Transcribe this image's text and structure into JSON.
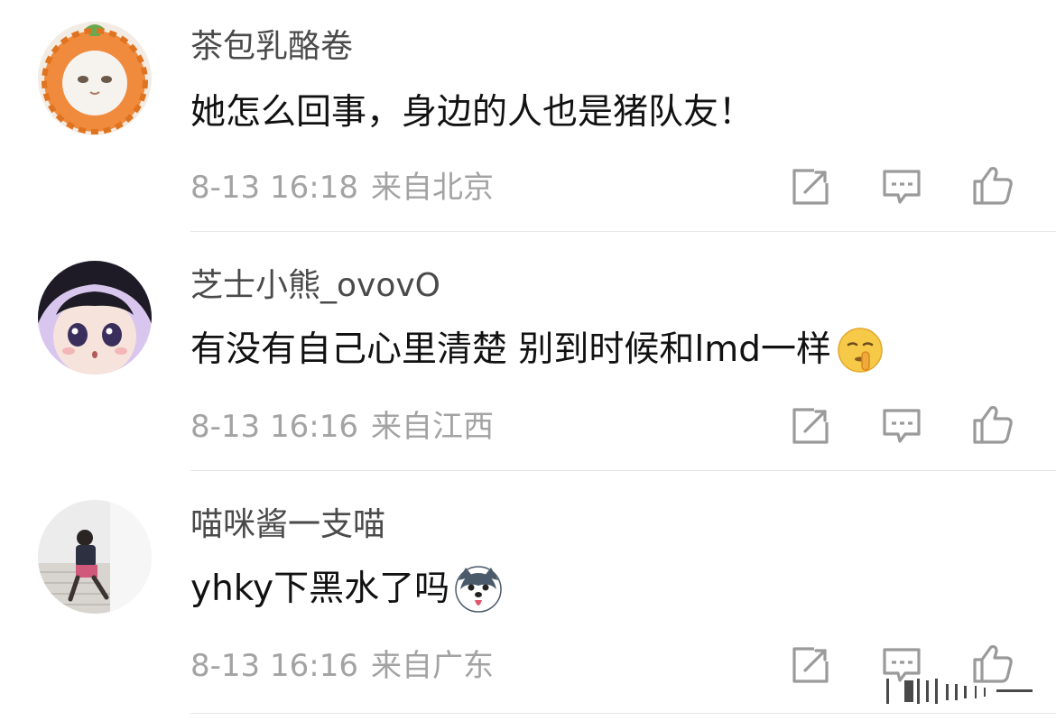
{
  "comments": [
    {
      "username": "茶包乳酪卷",
      "text": "她怎么回事，身边的人也是猪队友！",
      "time": "8-13 16:18",
      "location": "来自北京",
      "emoji": ""
    },
    {
      "username": "芝士小熊_ovovO",
      "text": "有没有自己心里清楚 别到时候和lmd一样",
      "time": "8-13 16:16",
      "location": "来自江西",
      "emoji": "shush-face-emoji"
    },
    {
      "username": "喵咪酱一支喵",
      "text": "yhky下黑水了吗",
      "time": "8-13 16:16",
      "location": "来自广东",
      "emoji": "husky-dog-emoji"
    }
  ],
  "icons": {
    "repost": "repost-icon",
    "comment": "comment-icon",
    "like": "like-icon"
  },
  "colors": {
    "username": "#4a4a4a",
    "text": "#111111",
    "meta": "#a3a3a3",
    "icon": "#9a9a9a",
    "divider": "#e6e6e6"
  }
}
